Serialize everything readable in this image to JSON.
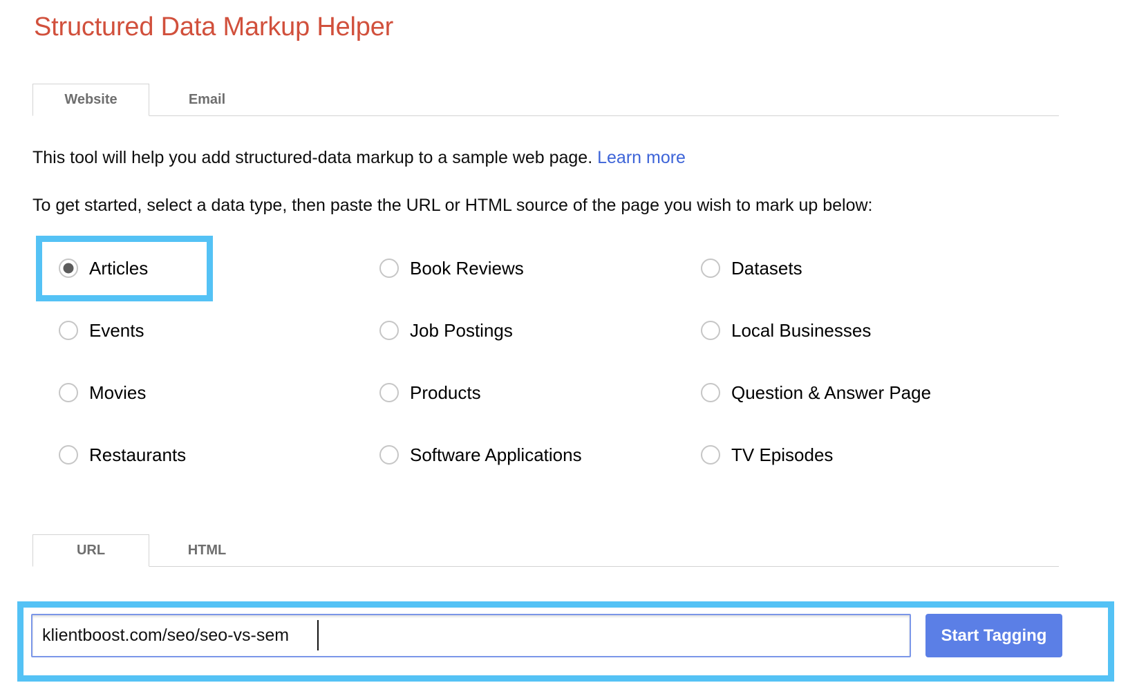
{
  "app": {
    "title": "Structured Data Markup Helper"
  },
  "top_tabs": {
    "items": [
      {
        "label": "Website",
        "active": true
      },
      {
        "label": "Email",
        "active": false
      }
    ]
  },
  "intro": {
    "line1_prefix": "This tool will help you add structured-data markup to a sample web page. ",
    "learn_more": "Learn more",
    "line2": "To get started, select a data type, then paste the URL or HTML source of the page you wish to mark up below:"
  },
  "data_types": {
    "selected": "Articles",
    "column1": [
      {
        "label": "Articles",
        "checked": true
      },
      {
        "label": "Events",
        "checked": false
      },
      {
        "label": "Movies",
        "checked": false
      },
      {
        "label": "Restaurants",
        "checked": false
      }
    ],
    "column2": [
      {
        "label": "Book Reviews",
        "checked": false
      },
      {
        "label": "Job Postings",
        "checked": false
      },
      {
        "label": "Products",
        "checked": false
      },
      {
        "label": "Software Applications",
        "checked": false
      }
    ],
    "column3": [
      {
        "label": "Datasets",
        "checked": false
      },
      {
        "label": "Local Businesses",
        "checked": false
      },
      {
        "label": "Question & Answer Page",
        "checked": false
      },
      {
        "label": "TV Episodes",
        "checked": false
      }
    ]
  },
  "source_tabs": {
    "items": [
      {
        "label": "URL",
        "active": true
      },
      {
        "label": "HTML",
        "active": false
      }
    ]
  },
  "url_form": {
    "value": "klientboost.com/seo/seo-vs-sem",
    "placeholder": "",
    "submit_label": "Start Tagging"
  },
  "annotations": {
    "highlight_color": "#54c2f5",
    "boxes": [
      {
        "target": "Articles radio option"
      },
      {
        "target": "URL input and Start Tagging button"
      }
    ]
  },
  "colors": {
    "title": "#d1503c",
    "link": "#3d64d8",
    "button": "#5b7fe6",
    "tab_text": "#6e6e6e",
    "highlight": "#54c2f5"
  }
}
